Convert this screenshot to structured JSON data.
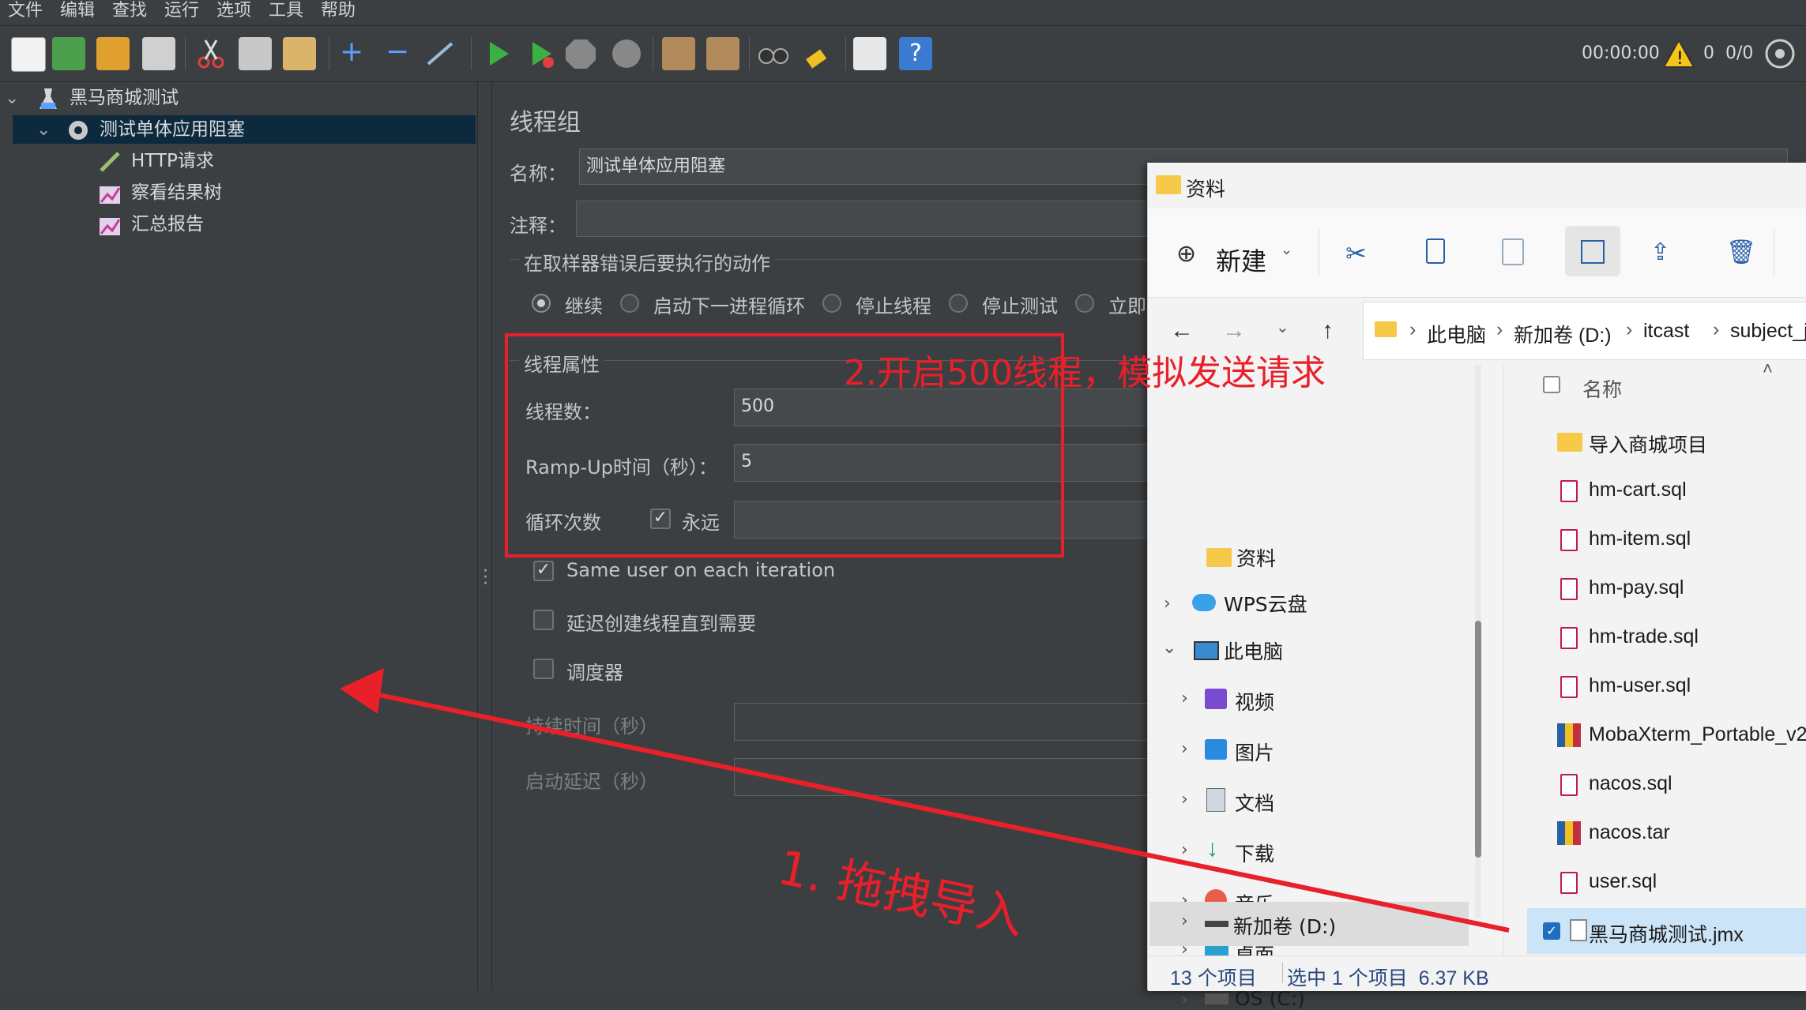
{
  "menu": [
    "文件",
    "编辑",
    "查找",
    "运行",
    "选项",
    "工具",
    "帮助"
  ],
  "toolbar": {
    "timer": "00:00:00",
    "warnings": "0",
    "threads": "0/0"
  },
  "tree": {
    "root": "黑马商城测试",
    "thread_group": "测试单体应用阻塞",
    "children": [
      "HTTP请求",
      "察看结果树",
      "汇总报告"
    ]
  },
  "panel": {
    "title": "线程组",
    "name_label": "名称：",
    "name_value": "测试单体应用阻塞",
    "comment_label": "注释：",
    "error_section": "在取样器错误后要执行的动作",
    "error_options": [
      "继续",
      "启动下一进程循环",
      "停止线程",
      "停止测试",
      "立即"
    ],
    "thread_props": "线程属性",
    "threads_label": "线程数：",
    "threads_value": "500",
    "rampup_label": "Ramp-Up时间（秒）：",
    "rampup_value": "5",
    "loop_label": "循环次数",
    "forever_label": "永远",
    "same_user": "Same user on each iteration",
    "delay_create": "延迟创建线程直到需要",
    "scheduler": "调度器",
    "duration_label": "持续时间（秒）",
    "startup_delay_label": "启动延迟（秒）"
  },
  "explorer": {
    "title": "资料",
    "new_label": "新建",
    "breadcrumb": [
      "此电脑",
      "新加卷 (D:)",
      "itcast",
      "subject_ja"
    ],
    "column_name": "名称",
    "nav_items": [
      "资料",
      "WPS云盘",
      "此电脑",
      "视频",
      "图片",
      "文档",
      "下载",
      "音乐",
      "桌面",
      "OS (C:)",
      "新加卷 (D:)"
    ],
    "files": [
      "导入商城项目",
      "hm-cart.sql",
      "hm-item.sql",
      "hm-pay.sql",
      "hm-trade.sql",
      "hm-user.sql",
      "MobaXterm_Portable_v2",
      "nacos.sql",
      "nacos.tar",
      "user.sql",
      "黑马商城测试.jmx"
    ],
    "status_count": "13 个项目",
    "status_selected": "选中 1 个项目  6.37 KB"
  },
  "annotations": {
    "step1": "1. 拖拽导入",
    "step2": "2.开启500线程，模拟发送请求"
  },
  "colors": {
    "annotation_red": "#e8202a",
    "selected_node": "#0d293e",
    "explorer_bg": "#f3f3f3"
  }
}
